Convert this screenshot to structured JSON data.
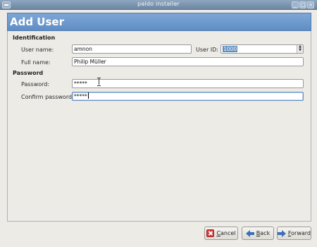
{
  "window": {
    "title": "paldo installer"
  },
  "header": {
    "title": "Add User"
  },
  "identification": {
    "section_label": "Identification",
    "username_label": "User name:",
    "username_value": "amnon",
    "userid_label": "User ID:",
    "userid_value": "1000",
    "fullname_label": "Full name:",
    "fullname_value": "Philip Müller"
  },
  "password": {
    "section_label": "Password",
    "password_label": "Password:",
    "password_value": "*****",
    "confirm_label": "Confirm password:",
    "confirm_value": "*****"
  },
  "buttons": {
    "cancel_mnemonic": "C",
    "cancel_rest": "ancel",
    "back_mnemonic": "B",
    "back_rest": "ack",
    "forward_mnemonic": "F",
    "forward_rest": "orward"
  },
  "colors": {
    "header": "#5f8dc5",
    "titlebar": "#7a95b2",
    "accent": "#3c6fb8",
    "cancel": "#d43d3d"
  },
  "icons": [
    "window-menu-icon",
    "minimize-icon",
    "maximize-icon",
    "close-icon",
    "cancel-icon",
    "back-arrow-icon",
    "forward-arrow-icon"
  ]
}
